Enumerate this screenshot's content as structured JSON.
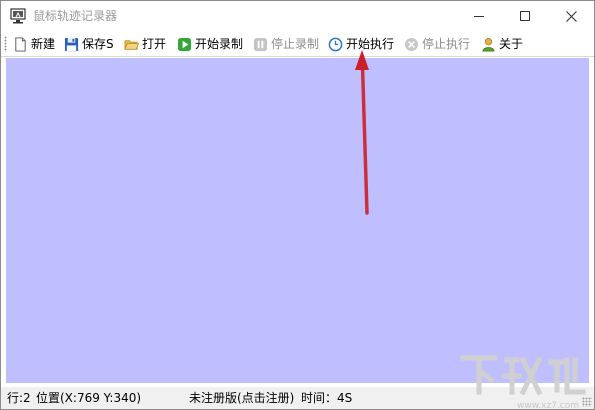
{
  "window": {
    "title": "鼠标轨迹记录器"
  },
  "toolbar": {
    "items": [
      {
        "label": "新建",
        "icon": "new-file-icon",
        "enabled": true
      },
      {
        "label": "保存S",
        "icon": "save-icon",
        "enabled": true
      },
      {
        "label": "打开",
        "icon": "open-folder-icon",
        "enabled": true
      },
      {
        "label": "开始录制",
        "icon": "play-icon",
        "enabled": true
      },
      {
        "label": "停止录制",
        "icon": "pause-icon",
        "enabled": false
      },
      {
        "label": "开始执行",
        "icon": "clock-icon",
        "enabled": true
      },
      {
        "label": "停止执行",
        "icon": "stop-x-icon",
        "enabled": false
      },
      {
        "label": "关于",
        "icon": "user-icon",
        "enabled": true
      }
    ]
  },
  "canvas": {
    "background": "#bfbfff"
  },
  "annotation": {
    "arrow_color": "#cc1f2a"
  },
  "statusbar": {
    "row": "行:2",
    "position": "位置(X:769 Y:340)",
    "registration": "未注册版(点击注册)",
    "time": "时间：4S"
  }
}
